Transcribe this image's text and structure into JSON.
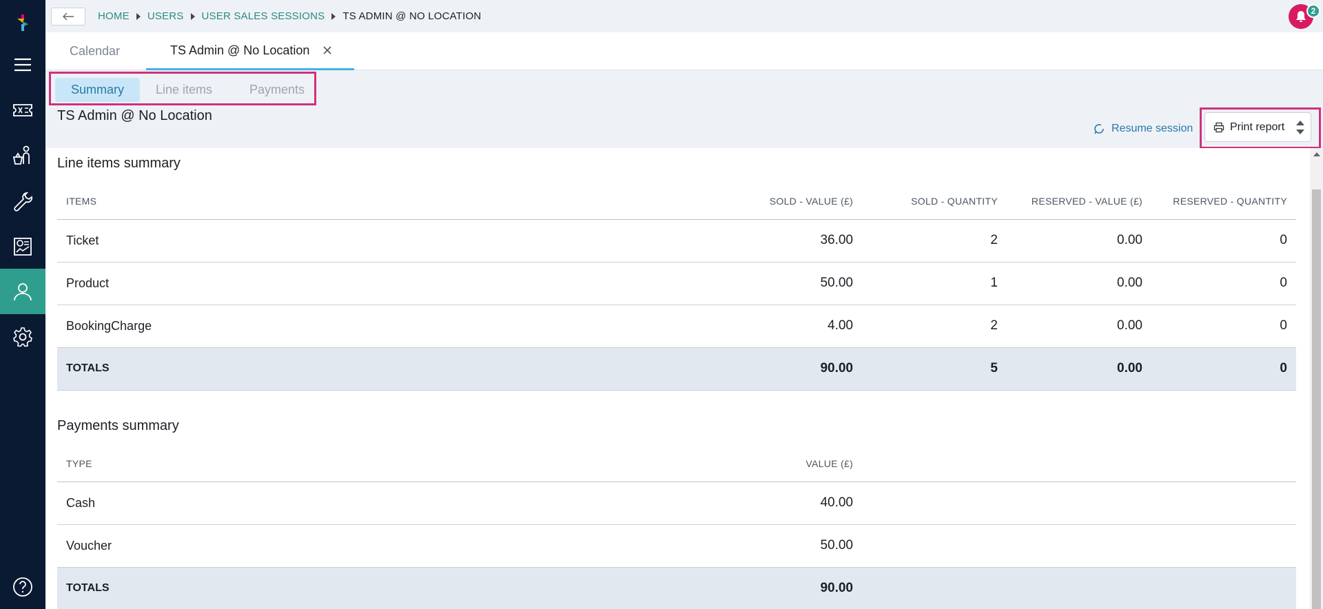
{
  "breadcrumb": {
    "items": [
      "HOME",
      "USERS",
      "USER SALES SESSIONS"
    ],
    "current": "TS ADMIN @ NO LOCATION"
  },
  "notifications": {
    "count": "2"
  },
  "tabs": [
    {
      "label": "Calendar"
    },
    {
      "label": "TS Admin @ No Location"
    }
  ],
  "subtabs": [
    {
      "label": "Summary"
    },
    {
      "label": "Line items"
    },
    {
      "label": "Payments"
    }
  ],
  "session": {
    "title": "TS Admin @ No Location",
    "resume_label": "Resume session",
    "print_label": "Print report"
  },
  "line_items": {
    "title": "Line items summary",
    "headers": [
      "ITEMS",
      "SOLD - VALUE (£)",
      "SOLD - QUANTITY",
      "RESERVED - VALUE (£)",
      "RESERVED - QUANTITY"
    ],
    "rows": [
      [
        "Ticket",
        "36.00",
        "2",
        "0.00",
        "0"
      ],
      [
        "Product",
        "50.00",
        "1",
        "0.00",
        "0"
      ],
      [
        "BookingCharge",
        "4.00",
        "2",
        "0.00",
        "0"
      ]
    ],
    "totals": [
      "TOTALS",
      "90.00",
      "5",
      "0.00",
      "0"
    ]
  },
  "payments": {
    "title": "Payments summary",
    "headers": [
      "TYPE",
      "VALUE (£)"
    ],
    "rows": [
      [
        "Cash",
        "40.00"
      ],
      [
        "Voucher",
        "50.00"
      ]
    ],
    "totals": [
      "TOTALS",
      "90.00"
    ]
  },
  "colors": {
    "sidebar": "#0a1a33",
    "accent": "#2f9e8f",
    "highlight": "#d0307c",
    "link": "#2a78a8"
  }
}
